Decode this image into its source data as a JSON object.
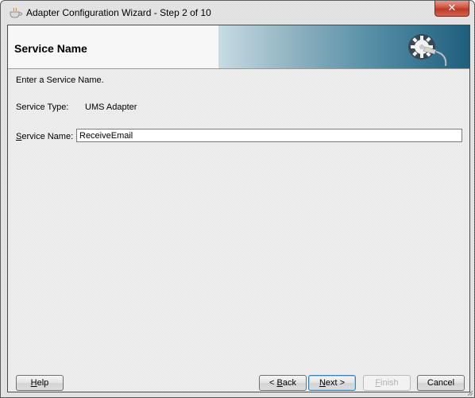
{
  "window": {
    "title": "Adapter Configuration Wizard - Step 2 of 10",
    "close_label": "✕",
    "app_icon": "coffee-cup-icon"
  },
  "header": {
    "title": "Service Name",
    "banner_icon": "gear-plug-icon"
  },
  "form": {
    "instruction": "Enter a Service Name.",
    "service_type_label": "Service Type:",
    "service_type_value": "UMS Adapter",
    "service_name_label_mnemonic": "S",
    "service_name_label_rest": "ervice Name:",
    "service_name_value": "ReceiveEmail"
  },
  "buttons": {
    "help_mnemonic": "H",
    "help_rest": "elp",
    "back_prefix": "< ",
    "back_mnemonic": "B",
    "back_rest": "ack",
    "next_mnemonic": "N",
    "next_rest": "ext >",
    "finish_mnemonic": "F",
    "finish_rest": "inish",
    "cancel": "Cancel"
  },
  "state": {
    "finish_enabled": false,
    "default_button": "next"
  }
}
